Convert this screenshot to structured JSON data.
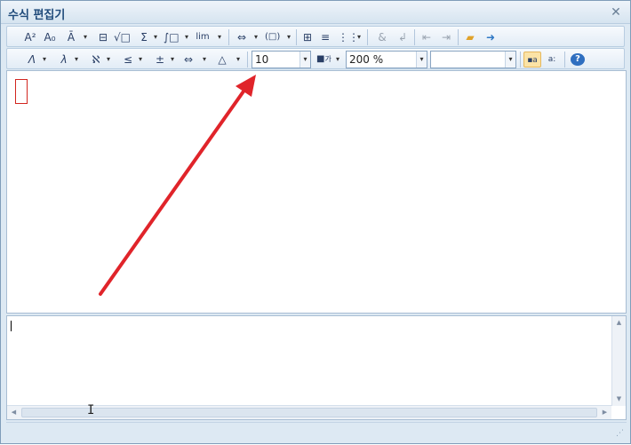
{
  "window": {
    "title": "수식 편집기",
    "close_label": "✕"
  },
  "toolbar1": {
    "buttons": [
      {
        "name": "superscript-icon",
        "glyph": "A²"
      },
      {
        "name": "subscript-icon",
        "glyph": "A₀"
      },
      {
        "name": "accent-icon",
        "glyph": "Ā"
      },
      {
        "name": "fraction-icon",
        "glyph": "⊟"
      },
      {
        "name": "root-icon",
        "glyph": "√□"
      },
      {
        "name": "sum-icon",
        "glyph": "Σ"
      },
      {
        "name": "integral-icon",
        "glyph": "∫□"
      },
      {
        "name": "limit-icon",
        "glyph": "lim"
      },
      {
        "name": "arrow-stack-icon",
        "glyph": "⇔"
      },
      {
        "name": "bracket-icon",
        "glyph": "(□)"
      },
      {
        "name": "matrix-icon",
        "glyph": "⊞"
      },
      {
        "name": "rows-icon",
        "glyph": "≡"
      },
      {
        "name": "grid-icon",
        "glyph": "⋮⋮"
      },
      {
        "name": "ampersand-icon",
        "glyph": "&"
      },
      {
        "name": "newline-icon",
        "glyph": "↲"
      },
      {
        "name": "prev-icon",
        "glyph": "⇤"
      },
      {
        "name": "next-icon",
        "glyph": "⇥"
      },
      {
        "name": "open-folder-icon",
        "glyph": "📂"
      },
      {
        "name": "insert-icon",
        "glyph": "➜"
      }
    ]
  },
  "toolbar2": {
    "symbol_buttons": [
      {
        "name": "greek-upper-icon",
        "glyph": "Λ"
      },
      {
        "name": "greek-lower-icon",
        "glyph": "λ"
      },
      {
        "name": "set-symbol-icon",
        "glyph": "ℵ"
      },
      {
        "name": "relation-icon",
        "glyph": "≤"
      },
      {
        "name": "operator-icon",
        "glyph": "±"
      },
      {
        "name": "arrow-icon",
        "glyph": "⇔"
      },
      {
        "name": "misc-symbol-icon",
        "glyph": "△"
      }
    ],
    "font_size": "10",
    "color_label": "■",
    "color_suffix": "가",
    "zoom": "200 %",
    "font_name": "",
    "help_label": "?"
  },
  "colors": {
    "accent": "#1f4a7a",
    "arrow": "#e0242a"
  }
}
